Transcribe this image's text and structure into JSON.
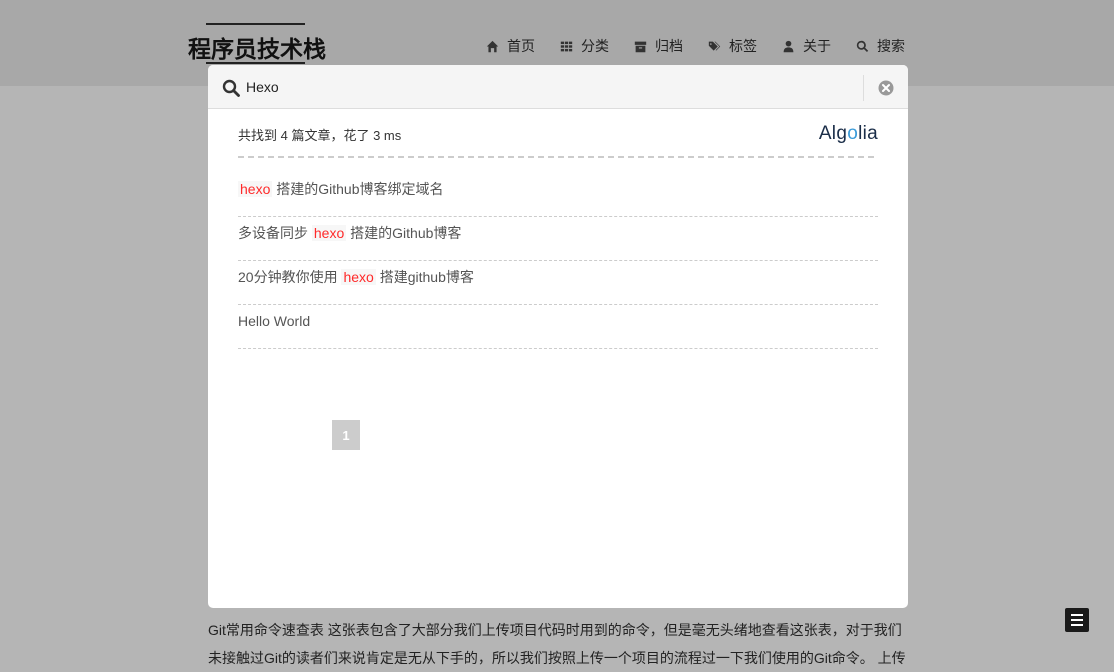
{
  "site": {
    "logo": "程序员技术栈"
  },
  "nav": {
    "items": [
      {
        "icon": "home-icon",
        "label": "首页"
      },
      {
        "icon": "th-grid-icon",
        "label": "分类"
      },
      {
        "icon": "archive-icon",
        "label": "归档"
      },
      {
        "icon": "tags-icon",
        "label": "标签"
      },
      {
        "icon": "user-icon",
        "label": "关于"
      },
      {
        "icon": "search-icon",
        "label": "搜索"
      }
    ]
  },
  "search": {
    "query": "Hexo",
    "stats": "共找到 4 篇文章，花了 3 ms",
    "provider": "Algolia",
    "hits": [
      {
        "parts": [
          {
            "text": "hexo",
            "hl": true
          },
          {
            "text": " 搭建的Github博客绑定域名",
            "hl": false
          }
        ]
      },
      {
        "parts": [
          {
            "text": "多设备同步 ",
            "hl": false
          },
          {
            "text": "hexo",
            "hl": true
          },
          {
            "text": " 搭建的Github博客",
            "hl": false
          }
        ]
      },
      {
        "parts": [
          {
            "text": "20分钟教你使用 ",
            "hl": false
          },
          {
            "text": "hexo",
            "hl": true
          },
          {
            "text": " 搭建github博客",
            "hl": false
          }
        ]
      },
      {
        "parts": [
          {
            "text": "Hello World",
            "hl": false
          }
        ]
      }
    ],
    "page": "1"
  },
  "article": {
    "text": "Git常用命令速查表 这张表包含了大部分我们上传项目代码时用到的命令，但是毫无头绪地查看这张表，对于我们未接触过Git的读者们来说肯定是无从下手的，所以我们按照上传一个项目的流程过一下我们使用的Git命令。 上传"
  },
  "colors": {
    "highlight": "#ff2a2a",
    "overlay": "#b5b5b5",
    "algolia_accent": "#3b9bd9"
  }
}
